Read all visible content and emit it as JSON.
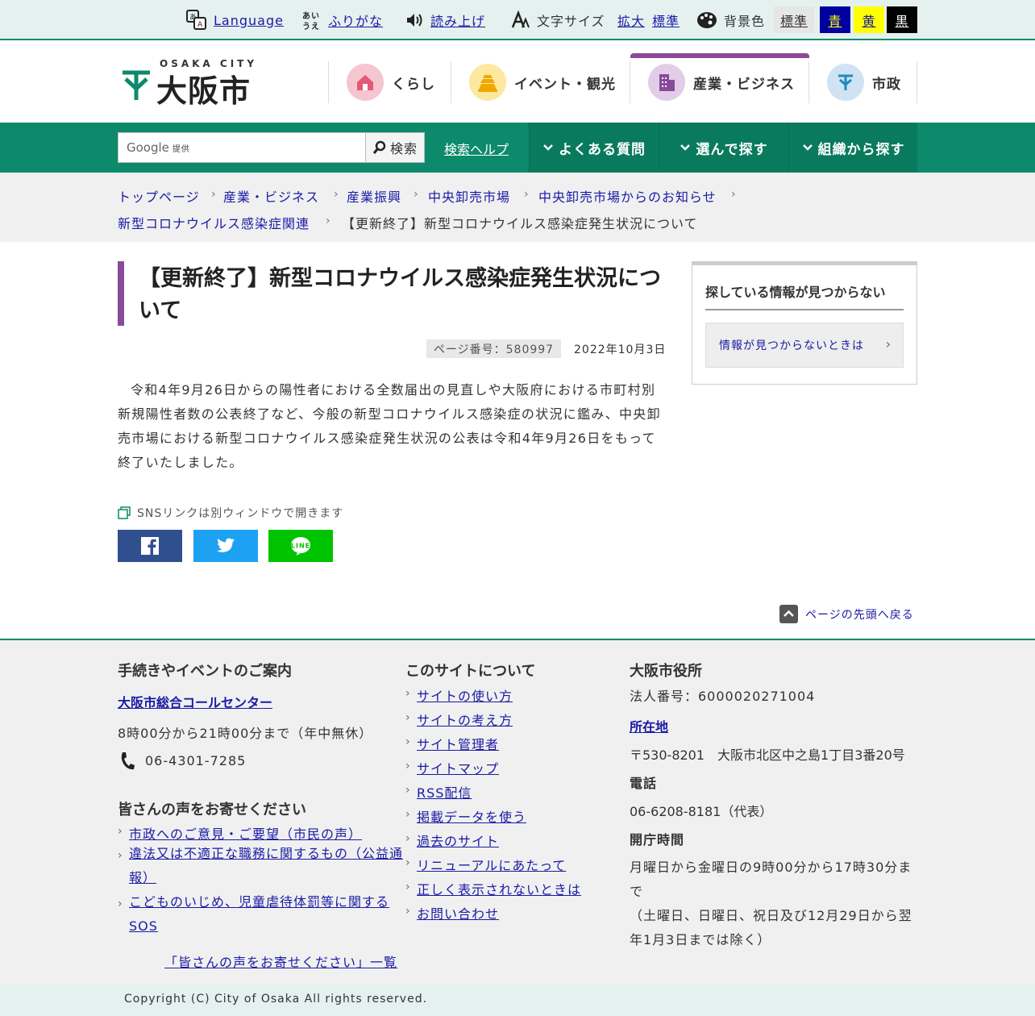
{
  "util": {
    "language": "Language",
    "furigana": "ふりがな",
    "read_aloud": "読み上げ",
    "font_size_label": "文字サイズ",
    "font_enlarge": "拡大",
    "font_standard": "標準",
    "bg_label": "背景色",
    "bg_standard": "標準",
    "bg_blue": "青",
    "bg_yellow": "黄",
    "bg_black": "黒"
  },
  "logo": {
    "sub": "OSAKA CITY",
    "main": "大阪市"
  },
  "gnav": [
    {
      "label": "くらし",
      "color": "#f5c6cf"
    },
    {
      "label": "イベント・観光",
      "color": "#fde8a0"
    },
    {
      "label": "産業・ビジネス",
      "color": "#e2cde8"
    },
    {
      "label": "市政",
      "color": "#cfe3f3"
    }
  ],
  "search": {
    "google_label": "Google",
    "provided": "提供",
    "button": "検索",
    "help": "検索ヘルプ"
  },
  "green_nav": [
    "よくある質問",
    "選んで探す",
    "組織から探す"
  ],
  "breadcrumb": [
    "トップページ",
    "産業・ビジネス",
    "産業振興",
    "中央卸売市場",
    "中央卸売市場からのお知らせ",
    "新型コロナウイルス感染症関連",
    "【更新終了】新型コロナウイルス感染症発生状況について"
  ],
  "main": {
    "title": "【更新終了】新型コロナウイルス感染症発生状況について",
    "page_number": "ページ番号：580997",
    "date": "2022年10月3日",
    "body": "令和4年9月26日からの陽性者における全数届出の見直しや大阪府における市町村別新規陽性者数の公表終了など、今般の新型コロナウイルス感染症の状況に鑑み、中央卸売市場における新型コロナウイルス感染症発生状況の公表は令和4年9月26日をもって終了いたしました。",
    "sns_note": "SNSリンクは別ウィンドウで開きます",
    "to_top": "ページの先頭へ戻る"
  },
  "sidebar": {
    "title": "探している情報が見つからない",
    "link": "情報が見つからないときは"
  },
  "footer": {
    "col1_head": "手続きやイベントのご案内",
    "call_center": "大阪市総合コールセンター",
    "hours": "8時00分から21時00分まで（年中無休）",
    "phone": "06-4301-7285",
    "voice_head": "皆さんの声をお寄せください",
    "voice_links": [
      "市政へのご意見・ご要望（市民の声）",
      "違法又は不適正な職務に関するもの（公益通報）",
      "こどものいじめ、児童虐待体罰等に関するSOS"
    ],
    "voice_list": "「皆さんの声をお寄せください」一覧",
    "col2_head": "このサイトについて",
    "site_links": [
      "サイトの使い方",
      "サイトの考え方",
      "サイト管理者",
      "サイトマップ",
      "RSS配信",
      "掲載データを使う",
      "過去のサイト",
      "リニューアルにあたって",
      "正しく表示されないときは",
      "お問い合わせ"
    ],
    "col3_head": "大阪市役所",
    "corp_number": "法人番号：6000020271004",
    "location_link": "所在地",
    "address": "〒530-8201　大阪市北区中之島1丁目3番20号",
    "tel_head": "電話",
    "tel": "06-6208-8181（代表）",
    "open_head": "開庁時間",
    "open_hours": "月曜日から金曜日の9時00分から17時30分まで",
    "open_note": "（土曜日、日曜日、祝日及び12月29日から翌年1月3日までは除く）",
    "copyright": "Copyright (C) City of Osaka All rights reserved."
  },
  "colors": {
    "brand_green": "#0d8a6b",
    "accent_purple": "#8a4a9a"
  }
}
